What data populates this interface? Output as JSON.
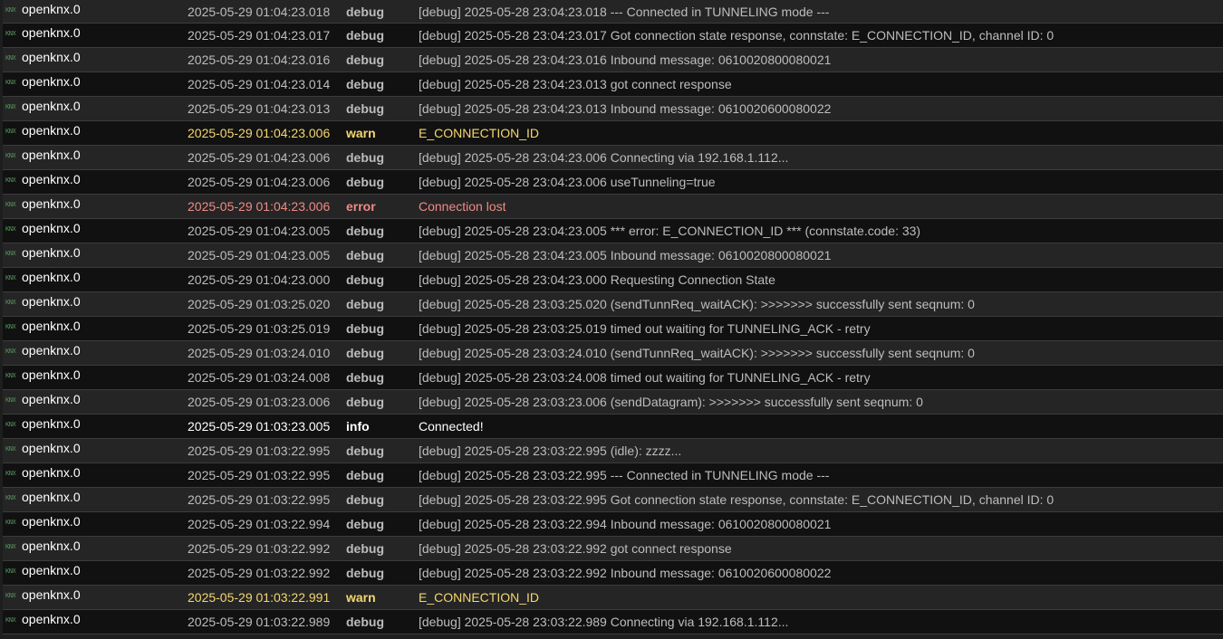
{
  "colors": {
    "debug": "#bdbdbd",
    "warn": "#f5d76e",
    "error": "#f08a84",
    "info": "#ffffff",
    "icon": "#3fa34d"
  },
  "rows": [
    {
      "icon": "knx-icon",
      "source": "openknx.0",
      "timestamp": "2025-05-29 01:04:23.018",
      "level": "debug",
      "message": "[debug] 2025-05-28 23:04:23.018 --- Connected in TUNNELING mode ---"
    },
    {
      "icon": "knx-icon",
      "source": "openknx.0",
      "timestamp": "2025-05-29 01:04:23.017",
      "level": "debug",
      "message": "[debug] 2025-05-28 23:04:23.017 Got connection state response, connstate: E_CONNECTION_ID, channel ID: 0"
    },
    {
      "icon": "knx-icon",
      "source": "openknx.0",
      "timestamp": "2025-05-29 01:04:23.016",
      "level": "debug",
      "message": "[debug] 2025-05-28 23:04:23.016 Inbound message: 0610020800080021"
    },
    {
      "icon": "knx-icon",
      "source": "openknx.0",
      "timestamp": "2025-05-29 01:04:23.014",
      "level": "debug",
      "message": "[debug] 2025-05-28 23:04:23.013 got connect response"
    },
    {
      "icon": "knx-icon",
      "source": "openknx.0",
      "timestamp": "2025-05-29 01:04:23.013",
      "level": "debug",
      "message": "[debug] 2025-05-28 23:04:23.013 Inbound message: 0610020600080022"
    },
    {
      "icon": "knx-icon",
      "source": "openknx.0",
      "timestamp": "2025-05-29 01:04:23.006",
      "level": "warn",
      "message": "E_CONNECTION_ID"
    },
    {
      "icon": "knx-icon",
      "source": "openknx.0",
      "timestamp": "2025-05-29 01:04:23.006",
      "level": "debug",
      "message": "[debug] 2025-05-28 23:04:23.006 Connecting via 192.168.1.112..."
    },
    {
      "icon": "knx-icon",
      "source": "openknx.0",
      "timestamp": "2025-05-29 01:04:23.006",
      "level": "debug",
      "message": "[debug] 2025-05-28 23:04:23.006 useTunneling=true"
    },
    {
      "icon": "knx-icon",
      "source": "openknx.0",
      "timestamp": "2025-05-29 01:04:23.006",
      "level": "error",
      "message": "Connection lost"
    },
    {
      "icon": "knx-icon",
      "source": "openknx.0",
      "timestamp": "2025-05-29 01:04:23.005",
      "level": "debug",
      "message": "[debug] 2025-05-28 23:04:23.005 *** error: E_CONNECTION_ID *** (connstate.code: 33)"
    },
    {
      "icon": "knx-icon",
      "source": "openknx.0",
      "timestamp": "2025-05-29 01:04:23.005",
      "level": "debug",
      "message": "[debug] 2025-05-28 23:04:23.005 Inbound message: 0610020800080021"
    },
    {
      "icon": "knx-icon",
      "source": "openknx.0",
      "timestamp": "2025-05-29 01:04:23.000",
      "level": "debug",
      "message": "[debug] 2025-05-28 23:04:23.000 Requesting Connection State"
    },
    {
      "icon": "knx-icon",
      "source": "openknx.0",
      "timestamp": "2025-05-29 01:03:25.020",
      "level": "debug",
      "message": "[debug] 2025-05-28 23:03:25.020 (sendTunnReq_waitACK): >>>>>>> successfully sent seqnum: 0"
    },
    {
      "icon": "knx-icon",
      "source": "openknx.0",
      "timestamp": "2025-05-29 01:03:25.019",
      "level": "debug",
      "message": "[debug] 2025-05-28 23:03:25.019 timed out waiting for TUNNELING_ACK - retry"
    },
    {
      "icon": "knx-icon",
      "source": "openknx.0",
      "timestamp": "2025-05-29 01:03:24.010",
      "level": "debug",
      "message": "[debug] 2025-05-28 23:03:24.010 (sendTunnReq_waitACK): >>>>>>> successfully sent seqnum: 0"
    },
    {
      "icon": "knx-icon",
      "source": "openknx.0",
      "timestamp": "2025-05-29 01:03:24.008",
      "level": "debug",
      "message": "[debug] 2025-05-28 23:03:24.008 timed out waiting for TUNNELING_ACK - retry"
    },
    {
      "icon": "knx-icon",
      "source": "openknx.0",
      "timestamp": "2025-05-29 01:03:23.006",
      "level": "debug",
      "message": "[debug] 2025-05-28 23:03:23.006 (sendDatagram): >>>>>>> successfully sent seqnum: 0"
    },
    {
      "icon": "knx-icon",
      "source": "openknx.0",
      "timestamp": "2025-05-29 01:03:23.005",
      "level": "info",
      "message": "Connected!"
    },
    {
      "icon": "knx-icon",
      "source": "openknx.0",
      "timestamp": "2025-05-29 01:03:22.995",
      "level": "debug",
      "message": "[debug] 2025-05-28 23:03:22.995 (idle): zzzz..."
    },
    {
      "icon": "knx-icon",
      "source": "openknx.0",
      "timestamp": "2025-05-29 01:03:22.995",
      "level": "debug",
      "message": "[debug] 2025-05-28 23:03:22.995 --- Connected in TUNNELING mode ---"
    },
    {
      "icon": "knx-icon",
      "source": "openknx.0",
      "timestamp": "2025-05-29 01:03:22.995",
      "level": "debug",
      "message": "[debug] 2025-05-28 23:03:22.995 Got connection state response, connstate: E_CONNECTION_ID, channel ID: 0"
    },
    {
      "icon": "knx-icon",
      "source": "openknx.0",
      "timestamp": "2025-05-29 01:03:22.994",
      "level": "debug",
      "message": "[debug] 2025-05-28 23:03:22.994 Inbound message: 0610020800080021"
    },
    {
      "icon": "knx-icon",
      "source": "openknx.0",
      "timestamp": "2025-05-29 01:03:22.992",
      "level": "debug",
      "message": "[debug] 2025-05-28 23:03:22.992 got connect response"
    },
    {
      "icon": "knx-icon",
      "source": "openknx.0",
      "timestamp": "2025-05-29 01:03:22.992",
      "level": "debug",
      "message": "[debug] 2025-05-28 23:03:22.992 Inbound message: 0610020600080022"
    },
    {
      "icon": "knx-icon",
      "source": "openknx.0",
      "timestamp": "2025-05-29 01:03:22.991",
      "level": "warn",
      "message": "E_CONNECTION_ID"
    },
    {
      "icon": "knx-icon",
      "source": "openknx.0",
      "timestamp": "2025-05-29 01:03:22.989",
      "level": "debug",
      "message": "[debug] 2025-05-28 23:03:22.989 Connecting via 192.168.1.112..."
    }
  ]
}
